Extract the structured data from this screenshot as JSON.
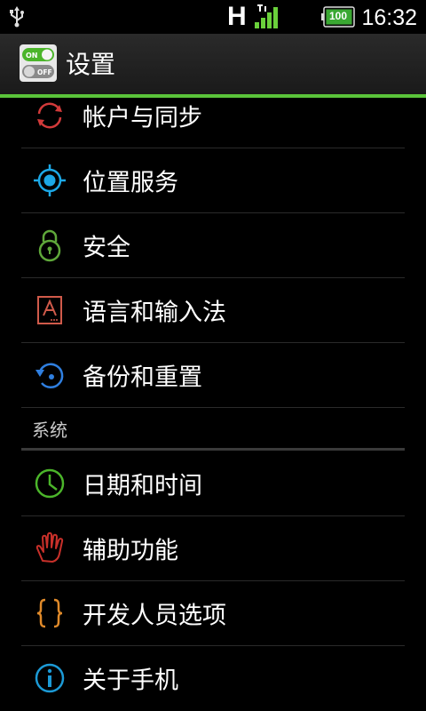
{
  "status_bar": {
    "network": "H",
    "battery": "100",
    "time": "16:32",
    "icons": [
      "usb-icon",
      "signal-icon",
      "battery-icon"
    ]
  },
  "action_bar": {
    "title": "设置",
    "icon": "settings-toggle-icon",
    "icon_on": "ON",
    "icon_off": "OFF"
  },
  "colors": {
    "accent": "#5bc43a",
    "background": "#000000",
    "divider": "#2a2a2a"
  },
  "items": [
    {
      "label": "帐户与同步",
      "icon": "sync-icon"
    },
    {
      "label": "位置服务",
      "icon": "location-icon"
    },
    {
      "label": "安全",
      "icon": "lock-icon"
    },
    {
      "label": "语言和输入法",
      "icon": "language-icon"
    },
    {
      "label": "备份和重置",
      "icon": "backup-icon"
    }
  ],
  "section": {
    "label": "系统"
  },
  "system_items": [
    {
      "label": "日期和时间",
      "icon": "clock-icon"
    },
    {
      "label": "辅助功能",
      "icon": "hand-icon"
    },
    {
      "label": "开发人员选项",
      "icon": "braces-icon"
    },
    {
      "label": "关于手机",
      "icon": "info-icon"
    }
  ]
}
